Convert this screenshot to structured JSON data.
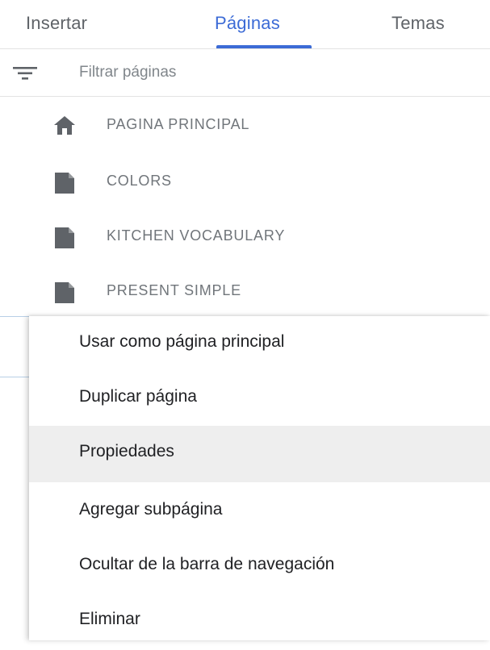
{
  "tabs": [
    {
      "label": "Insertar"
    },
    {
      "label": "Páginas"
    },
    {
      "label": "Temas"
    }
  ],
  "filter": {
    "placeholder": "Filtrar páginas",
    "icon": "filter-icon"
  },
  "pages": [
    {
      "label": "PAGINA PRINCIPAL",
      "icon": "home-icon"
    },
    {
      "label": "COLORS",
      "icon": "page-icon"
    },
    {
      "label": "KITCHEN VOCABULARY",
      "icon": "page-icon"
    },
    {
      "label": "PRESENT SIMPLE",
      "icon": "page-icon"
    }
  ],
  "context_menu": {
    "items": [
      {
        "label": "Usar como página principal"
      },
      {
        "label": "Duplicar página"
      },
      {
        "label": "Propiedades"
      },
      {
        "label": "Agregar subpágina"
      },
      {
        "label": "Ocultar de la barra de navegación"
      },
      {
        "label": "Eliminar"
      }
    ]
  },
  "colors": {
    "accent": "#3c6bd6",
    "icon": "#5f6368",
    "hover": "#eeeeee"
  }
}
